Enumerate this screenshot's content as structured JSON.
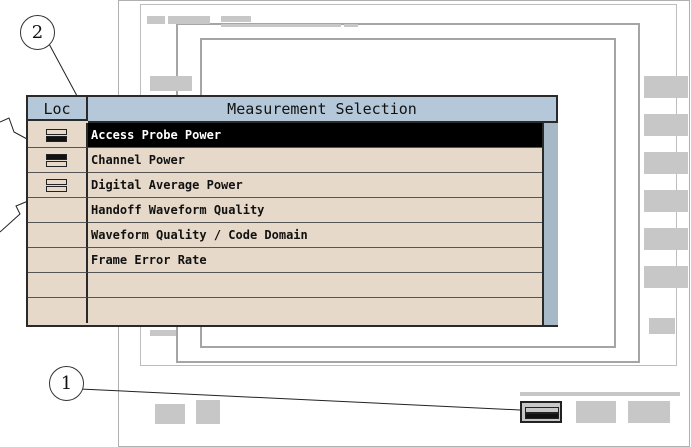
{
  "callouts": {
    "one": "1",
    "two": "2"
  },
  "window": {
    "loc_header": "Loc",
    "title": "Measurement Selection",
    "rows": [
      {
        "label": "Access Probe Power",
        "loc": "bottom",
        "selected": true
      },
      {
        "label": "Channel Power",
        "loc": "top",
        "selected": false
      },
      {
        "label": "Digital Average Power",
        "loc": "none-filled",
        "selected": false
      },
      {
        "label": "Handoff Waveform Quality",
        "loc": "",
        "selected": false
      },
      {
        "label": "Waveform Quality / Code Domain",
        "loc": "",
        "selected": false
      },
      {
        "label": "Frame Error Rate",
        "loc": "",
        "selected": false
      },
      {
        "label": "",
        "loc": "",
        "selected": false
      },
      {
        "label": "",
        "loc": "",
        "selected": false
      }
    ]
  },
  "colors": {
    "list_bg": "#e6d9c9",
    "header_bg": "#b5c8d9",
    "selection": "#000000",
    "softkey": "#c7c7c7"
  }
}
